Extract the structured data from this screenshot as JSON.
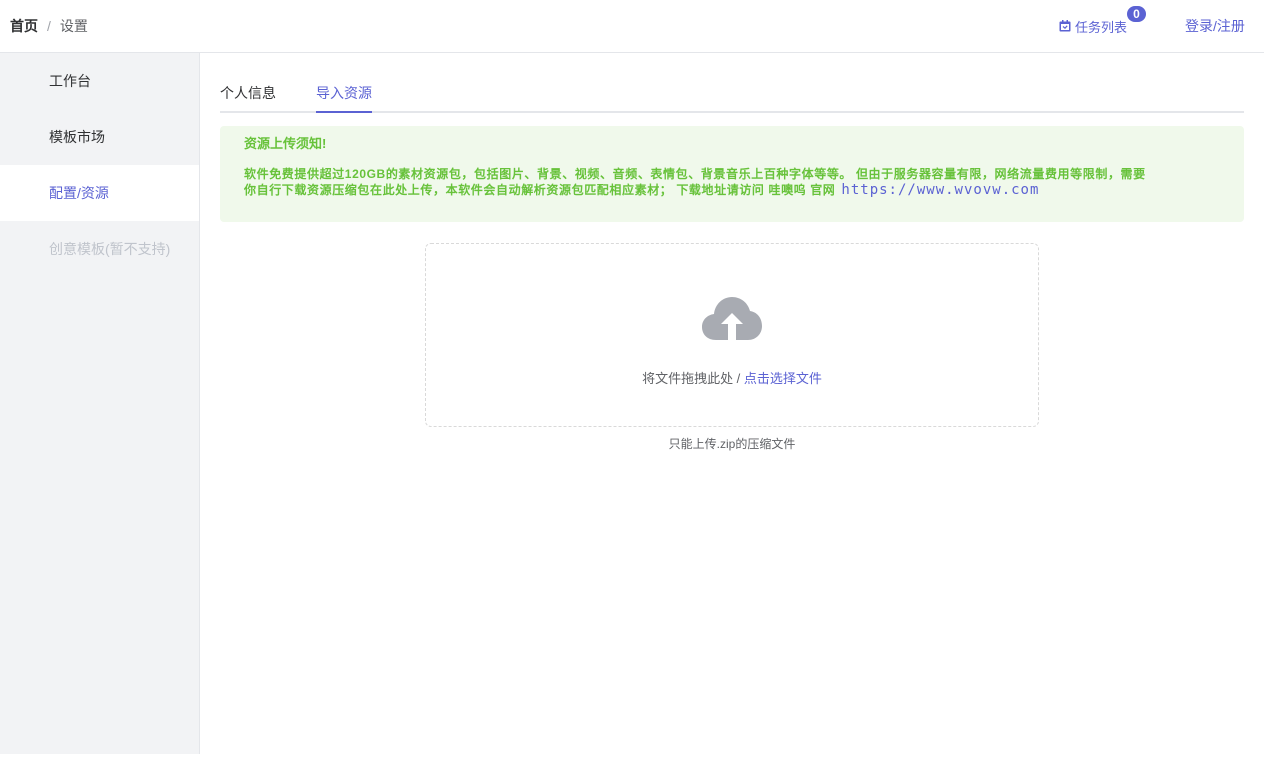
{
  "breadcrumb": {
    "home": "首页",
    "separator": "/",
    "current": "设置"
  },
  "header": {
    "task_list_label": "任务列表",
    "task_count": "0",
    "login_label": "登录/注册"
  },
  "sidebar": {
    "items": [
      {
        "label": "工作台",
        "state": "normal"
      },
      {
        "label": "模板市场",
        "state": "normal"
      },
      {
        "label": "配置/资源",
        "state": "active"
      },
      {
        "label": "创意模板(暂不支持)",
        "state": "disabled"
      }
    ]
  },
  "tabs": [
    {
      "label": "个人信息",
      "active": false
    },
    {
      "label": "导入资源",
      "active": true
    }
  ],
  "notice": {
    "title": "资源上传须知!",
    "body_line1": "软件免费提供超过120GB的素材资源包，包括图片、背景、视频、音频、表情包、背景音乐上百种字体等等。 但由于服务器容量有限，网络流量费用等限制，需要",
    "body_line2": "你自行下载资源压缩包在此处上传，本软件会自动解析资源包匹配相应素材； 下载地址请访问 哇噢呜 官网",
    "link": "https://www.wvovw.com"
  },
  "upload": {
    "icon": "cloud-upload-icon",
    "drag_text": "将文件拖拽此处 / ",
    "click_text": "点击选择文件",
    "tip": "只能上传.zip的压缩文件"
  },
  "colors": {
    "accent": "#5b62d3",
    "success": "#67c23a",
    "notice_bg": "#f0f9eb",
    "sidebar_bg": "#f2f3f5"
  }
}
